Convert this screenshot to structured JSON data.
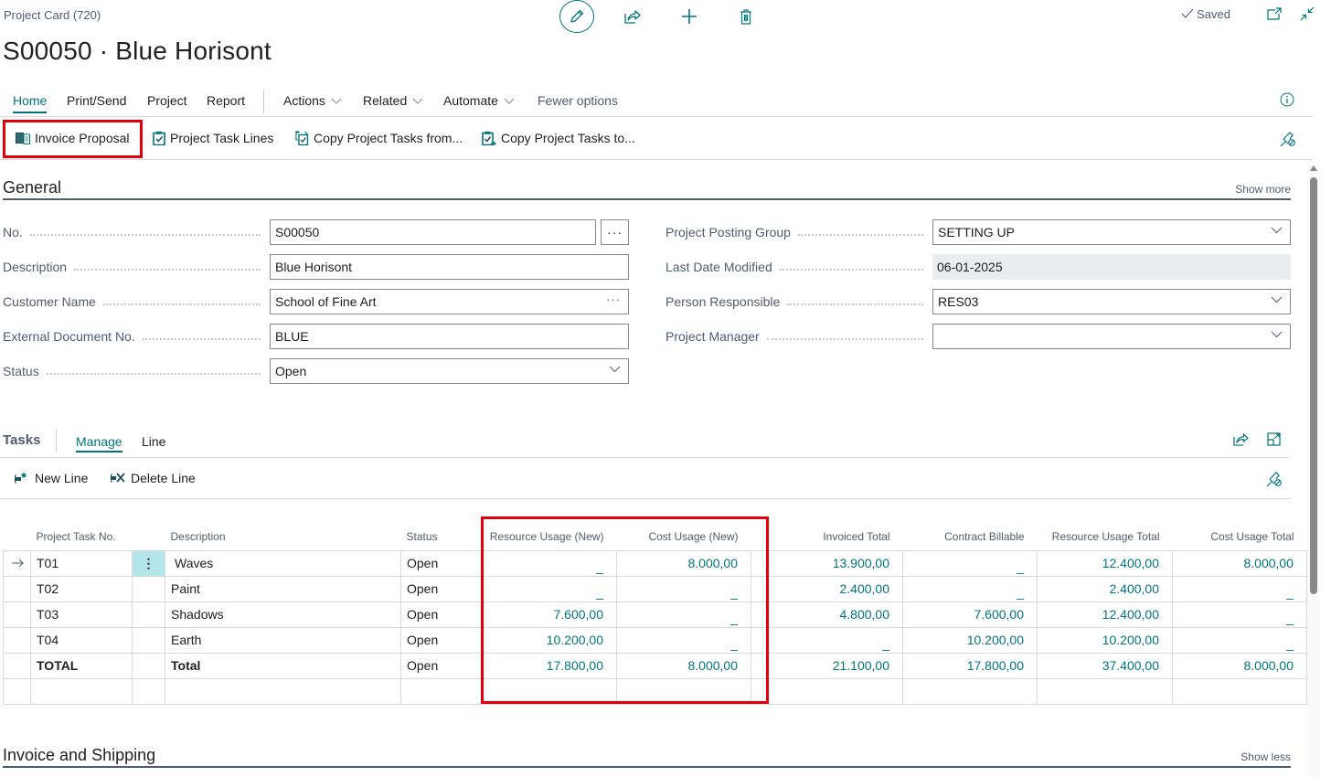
{
  "header": {
    "caption": "Project Card (720)",
    "title": "S00050 · Blue Horisont",
    "saved_label": "Saved",
    "top_actions": [
      "edit-icon",
      "share-icon",
      "new-icon",
      "delete-icon",
      "open-new-window-icon",
      "collapse-icon"
    ]
  },
  "nav": {
    "tabs": [
      {
        "label": "Home",
        "active": true
      },
      {
        "label": "Print/Send"
      },
      {
        "label": "Project"
      },
      {
        "label": "Report"
      }
    ],
    "menus": [
      {
        "label": "Actions"
      },
      {
        "label": "Related"
      },
      {
        "label": "Automate"
      }
    ],
    "fewer_options": "Fewer options"
  },
  "actionbar": {
    "items": [
      {
        "label": "Invoice Proposal",
        "icon": "invoice-proposal-icon",
        "highlighted": true
      },
      {
        "label": "Project Task Lines",
        "icon": "clipboard-check-icon"
      },
      {
        "label": "Copy Project Tasks from...",
        "icon": "copy-from-icon"
      },
      {
        "label": "Copy Project Tasks to...",
        "icon": "copy-to-icon"
      }
    ]
  },
  "general": {
    "title": "General",
    "show_more": "Show more",
    "left_fields": [
      {
        "label": "No.",
        "value": "S00050",
        "type": "text-assist"
      },
      {
        "label": "Description",
        "value": "Blue Horisont",
        "type": "text"
      },
      {
        "label": "Customer Name",
        "value": "School of Fine Art",
        "type": "lookup"
      },
      {
        "label": "External Document No.",
        "value": "BLUE",
        "type": "text"
      },
      {
        "label": "Status",
        "value": "Open",
        "type": "select"
      }
    ],
    "right_fields": [
      {
        "label": "Project Posting Group",
        "value": "SETTING UP",
        "type": "select"
      },
      {
        "label": "Last Date Modified",
        "value": "06-01-2025",
        "type": "readonly"
      },
      {
        "label": "Person Responsible",
        "value": "RES03",
        "type": "select"
      },
      {
        "label": "Project Manager",
        "value": "",
        "type": "select"
      }
    ],
    "assist_label": "···",
    "lookup_label": "···"
  },
  "tasks": {
    "title": "Tasks",
    "tabs": [
      {
        "label": "Manage",
        "active": true
      },
      {
        "label": "Line"
      }
    ],
    "actions": [
      {
        "label": "New Line"
      },
      {
        "label": "Delete Line"
      }
    ],
    "columns": [
      "Project Task No.",
      "",
      "Description",
      "Status",
      "Resource Usage (New)",
      "Cost Usage (New)",
      "",
      "Invoiced Total",
      "Contract Billable",
      "Resource Usage Total",
      "Cost Usage Total"
    ],
    "rows": [
      {
        "task_no": "T01",
        "description": "Waves",
        "status": "Open",
        "resource_usage_new": "_",
        "cost_usage_new": "8.000,00",
        "invoiced_total": "13.900,00",
        "contract_billable": "_",
        "resource_usage_total": "12.400,00",
        "cost_usage_total": "8.000,00",
        "selected": true
      },
      {
        "task_no": "T02",
        "description": "Paint",
        "status": "Open",
        "resource_usage_new": "_",
        "cost_usage_new": "_",
        "invoiced_total": "2.400,00",
        "contract_billable": "_",
        "resource_usage_total": "2.400,00",
        "cost_usage_total": "_"
      },
      {
        "task_no": "T03",
        "description": "Shadows",
        "status": "Open",
        "resource_usage_new": "7.600,00",
        "cost_usage_new": "_",
        "invoiced_total": "4.800,00",
        "contract_billable": "7.600,00",
        "resource_usage_total": "12.400,00",
        "cost_usage_total": "_"
      },
      {
        "task_no": "T04",
        "description": "Earth",
        "status": "Open",
        "resource_usage_new": "10.200,00",
        "cost_usage_new": "_",
        "invoiced_total": "_",
        "contract_billable": "10.200,00",
        "resource_usage_total": "10.200,00",
        "cost_usage_total": "_"
      },
      {
        "task_no": "TOTAL",
        "description": "Total",
        "status": "Open",
        "resource_usage_new": "17.800,00",
        "cost_usage_new": "8.000,00",
        "invoiced_total": "21.100,00",
        "contract_billable": "17.800,00",
        "resource_usage_total": "37.400,00",
        "cost_usage_total": "8.000,00",
        "bold": true
      },
      {
        "task_no": "",
        "description": "",
        "status": "",
        "resource_usage_new": "",
        "cost_usage_new": "",
        "invoiced_total": "",
        "contract_billable": "",
        "resource_usage_total": "",
        "cost_usage_total": ""
      }
    ]
  },
  "invoice_shipping": {
    "title": "Invoice and Shipping",
    "show_less": "Show less"
  },
  "colors": {
    "accent": "#00757a",
    "highlight": "#e0000b",
    "selected_cell": "#b2e6ea"
  }
}
